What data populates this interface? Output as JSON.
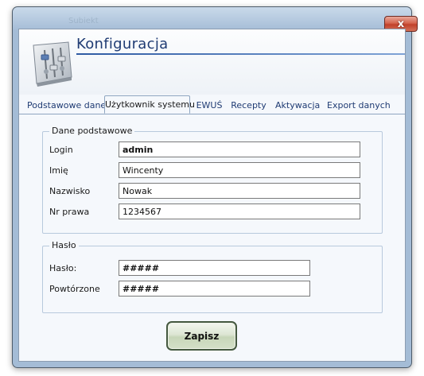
{
  "window": {
    "title_ghost": "Subiekt",
    "close_glyph": "x"
  },
  "header": {
    "title": "Konfiguracja",
    "logo_icon": "settings-sliders-icon"
  },
  "tabs": [
    {
      "label": "Podstawowe dane",
      "active": false
    },
    {
      "label": "Użytkownik systemu",
      "active": true
    },
    {
      "label": "EWUŚ",
      "active": false
    },
    {
      "label": "Recepty",
      "active": false
    },
    {
      "label": "Aktywacja",
      "active": false
    },
    {
      "label": "Export danych",
      "active": false
    }
  ],
  "basic": {
    "legend": "Dane podstawowe",
    "login_label": "Login",
    "login_value": "admin",
    "first_name_label": "Imię",
    "first_name_value": "Wincenty",
    "last_name_label": "Nazwisko",
    "last_name_value": "Nowak",
    "license_label": "Nr prawa",
    "license_value": "1234567"
  },
  "password": {
    "legend": "Hasło",
    "password_label": "Hasło:",
    "password_value": "#####",
    "repeat_label": "Powtórzone",
    "repeat_value": "#####"
  },
  "actions": {
    "save_label": "Zapisz"
  },
  "colors": {
    "accent_title": "#1f3b73",
    "save_border": "#44583f",
    "close_button": "#c1402a"
  }
}
